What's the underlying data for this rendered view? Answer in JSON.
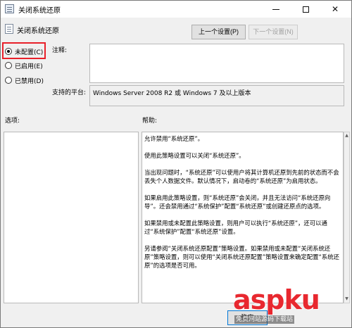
{
  "window": {
    "title": "关闭系统还原",
    "controls": [
      "minimize",
      "maximize",
      "close"
    ]
  },
  "header": {
    "title": "关闭系统还原",
    "prev_button": "上一个设置(P)",
    "next_button": "下一个设置(N)"
  },
  "state": {
    "options": [
      {
        "label": "未配置(C)",
        "selected": true
      },
      {
        "label": "已启用(E)",
        "selected": false
      },
      {
        "label": "已禁用(D)",
        "selected": false
      }
    ]
  },
  "comment": {
    "label": "注释:",
    "value": ""
  },
  "platform": {
    "label": "支持的平台:",
    "value": "Windows Server 2008 R2 或 Windows 7 及以上版本"
  },
  "options_section": {
    "label": "选项:"
  },
  "help_section": {
    "label": "帮助:",
    "paragraphs": [
      "允许禁用“系统还原”。",
      "使用此策略设置可以关闭“系统还原”。",
      "当出现问题时，“系统还原”可以使用户将其计算机还原到先前的状态而不会丢失个人数据文件。默认情况下，启动卷的“系统还原”为启用状态。",
      "如果启用此策略设置，则“系统还原”会关闭，并且无法访问“系统还原向导”。还会禁用通过“系统保护”配置“系统还原”或创建还原点的选项。",
      "如果禁用或未配置此策略设置，则用户可以执行“系统还原”，还可以通过“系统保护”配置“系统还原”设置。",
      "另请参阅“关闭系统还原配置”策略设置。如果禁用或未配置“关闭系统还原”策略设置，则可以使用“关闭系统还原配置”策略设置来确定配置“系统还原”的选项是否可用。"
    ]
  },
  "footer": {
    "ok_button": "确定"
  },
  "watermark": {
    "main": "aspku",
    "sub": "免费网站源码下载站"
  },
  "colors": {
    "highlight": "#e8202a",
    "watermark": "#e8282f"
  }
}
